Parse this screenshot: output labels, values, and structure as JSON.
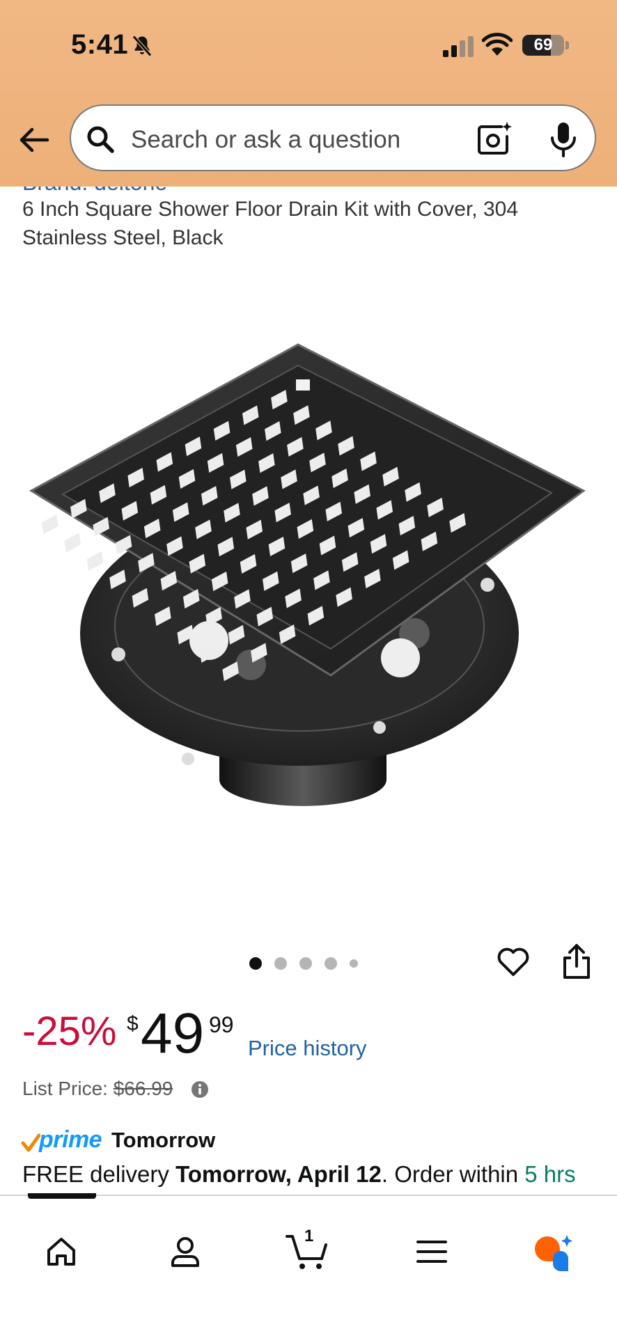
{
  "status_bar": {
    "time": "5:41",
    "battery": "69",
    "battery_level": 0.69
  },
  "search": {
    "placeholder": "Search or ask a question"
  },
  "product": {
    "brand_partial": "Brand: deltone",
    "title": "6 Inch Square Shower Floor Drain Kit with Cover, 304 Stainless Steel, Black",
    "image_count": 5,
    "active_image": 0
  },
  "pricing": {
    "discount": "-25%",
    "currency_symbol": "$",
    "price_whole": "49",
    "price_fraction": "99",
    "price_history_label": "Price history",
    "list_price_label": "List Price:",
    "list_price": "$66.99"
  },
  "delivery": {
    "prime_label": "prime",
    "prime_speed": "Tomorrow",
    "text_prefix": "FREE delivery ",
    "date": "Tomorrow, April 12",
    "text_mid": ". Order within ",
    "countdown": "5 hrs"
  },
  "nav": {
    "cart_count": "1"
  },
  "colors": {
    "header_bg": "#f1b885",
    "discount": "#cc0c39",
    "link": "#2162a1",
    "prime_blue": "#1399ff",
    "countdown_green": "#067d62"
  },
  "icons": [
    "bell-off-icon",
    "back-arrow-icon",
    "search-icon",
    "camera-icon",
    "microphone-icon",
    "heart-icon",
    "share-icon",
    "info-icon",
    "home-icon",
    "account-icon",
    "cart-icon",
    "menu-icon",
    "rufus-icon"
  ]
}
